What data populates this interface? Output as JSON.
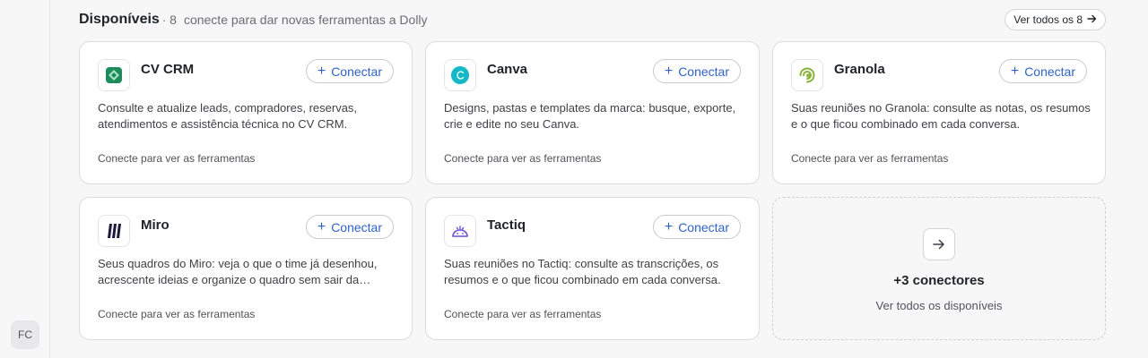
{
  "sidebar": {
    "avatar_initials": "FC"
  },
  "section": {
    "title": "Disponíveis",
    "dot": "·",
    "count": "8",
    "subtitle": "conecte para dar novas ferramentas a Dolly",
    "view_all_label": "Ver todos os 8"
  },
  "connect_label": "Conectar",
  "cards": [
    {
      "name": "CV CRM",
      "icon": "cvcrm-logo-icon",
      "description": "Consulte e atualize leads, compradores, reservas, atendimentos e assistência técnica no CV CRM.",
      "footer": "Conecte para ver as ferramentas"
    },
    {
      "name": "Canva",
      "icon": "canva-logo-icon",
      "description": "Designs, pastas e templates da marca: busque, exporte, crie e edite no seu Canva.",
      "footer": "Conecte para ver as ferramentas"
    },
    {
      "name": "Granola",
      "icon": "granola-logo-icon",
      "description": "Suas reuniões no Granola: consulte as notas, os resumos e o que ficou combinado em cada conversa.",
      "footer": "Conecte para ver as ferramentas"
    },
    {
      "name": "Miro",
      "icon": "miro-logo-icon",
      "description": "Seus quadros do Miro: veja o que o time já desenhou, acrescente ideias e organize o quadro sem sair da…",
      "footer": "Conecte para ver as ferramentas"
    },
    {
      "name": "Tactiq",
      "icon": "tactiq-logo-icon",
      "description": "Suas reuniões no Tactiq: consulte as transcrições, os resumos e o que ficou combinado em cada conversa.",
      "footer": "Conecte para ver as ferramentas"
    }
  ],
  "more": {
    "title": "+3 conectores",
    "subtitle": "Ver todos os disponíveis"
  },
  "colors": {
    "accent": "#2f63c6",
    "cvcrm": "#1f8a5b",
    "canva": "#14b8c7",
    "granola": "#8ab33b",
    "miro": "#1a1a3a",
    "tactiq": "#6d4fd6"
  }
}
